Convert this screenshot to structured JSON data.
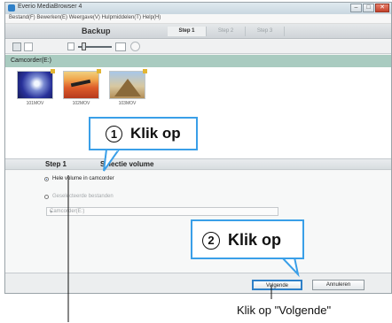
{
  "window": {
    "title": "Everio MediaBrowser 4",
    "menu_text": "Bestand(F)   Bewerken(E)   Weergave(V)   Hulpmiddelen(T)   Help(H)"
  },
  "header": {
    "title": "Backup",
    "steps": [
      "Step 1",
      "Step 2",
      "Step 3"
    ],
    "active_step": 0
  },
  "toolbar": {
    "icons": [
      "thumbnail-grid-icon",
      "list-view-icon",
      "zoom-small-icon",
      "zoom-slider",
      "zoom-large-icon",
      "disc-icon"
    ]
  },
  "source": {
    "label": "Camcorder(E:)",
    "thumbnails": [
      {
        "caption": "101MOV",
        "icon": "video-thumbnail"
      },
      {
        "caption": "102MOV",
        "icon": "plane-thumbnail"
      },
      {
        "caption": "103MOV",
        "icon": "pyramid-thumbnail"
      }
    ]
  },
  "step_bar": {
    "step": "Step 1",
    "text": "Selectie volume"
  },
  "options": {
    "option1": "Hele volume in camcorder",
    "option2": "Geselecteerde bestanden",
    "select_value": "Camcorder(E:)"
  },
  "buttons": {
    "next": "Volgende",
    "cancel": "Annuleren"
  },
  "callouts": {
    "c1_num": "1",
    "c1_text": "Klik op",
    "c2_num": "2",
    "c2_text": "Klik op"
  },
  "caption": "Klik op \"Volgende\"",
  "colors": {
    "callout_border": "#3a9fe8",
    "source_header": "#a9cbc0"
  }
}
